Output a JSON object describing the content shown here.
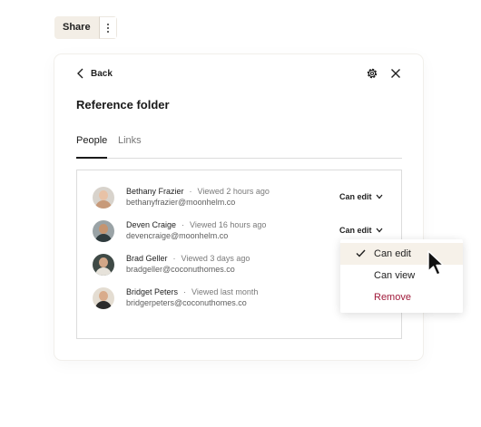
{
  "share": {
    "label": "Share",
    "more_icon": "more-vertical-icon"
  },
  "dialog": {
    "back_label": "Back",
    "title": "Reference folder",
    "tabs": [
      {
        "label": "People",
        "active": true
      },
      {
        "label": "Links",
        "active": false
      }
    ]
  },
  "people": [
    {
      "name": "Bethany Frazier",
      "viewed": "Viewed 2 hours ago",
      "email": "bethanyfrazier@moonhelm.co",
      "permission": "Can edit"
    },
    {
      "name": "Deven Craige",
      "viewed": "Viewed 16 hours ago",
      "email": "devencraige@moonhelm.co",
      "permission": "Can edit"
    },
    {
      "name": "Brad Geller",
      "viewed": "Viewed 3 days ago",
      "email": "bradgeller@coconuthomes.co",
      "permission": ""
    },
    {
      "name": "Bridget Peters",
      "viewed": "Viewed last month",
      "email": "bridgerpeters@coconuthomes.co",
      "permission": ""
    }
  ],
  "permission_menu": {
    "items": [
      {
        "label": "Can edit",
        "selected": true
      },
      {
        "label": "Can view",
        "selected": false
      },
      {
        "label": "Remove",
        "selected": false
      }
    ]
  },
  "colors": {
    "share_bg": "#f3eee6",
    "remove": "#a01a3a",
    "menu_selected": "#f6f1e9"
  }
}
